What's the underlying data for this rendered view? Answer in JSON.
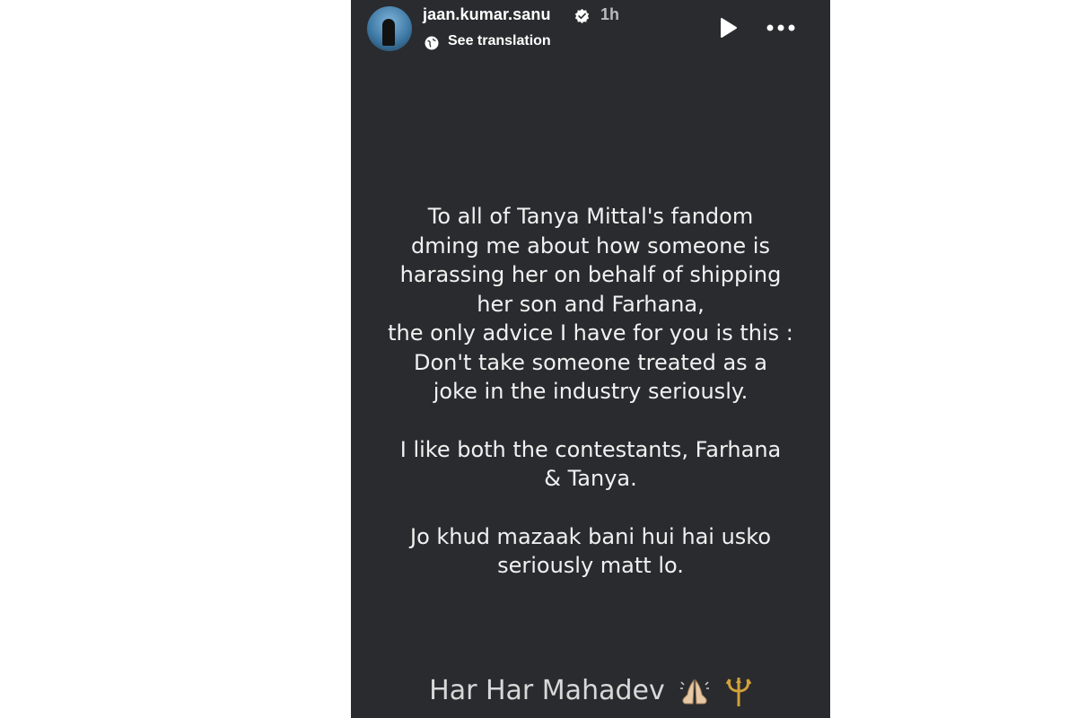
{
  "header": {
    "username": "jaan.kumar.sanu",
    "time": "1h",
    "translate_label": "See translation"
  },
  "icons": {
    "avatar": "profile-avatar",
    "verified": "verified-badge-icon",
    "globe": "globe-icon",
    "play": "play-icon",
    "more": "more-options-icon",
    "hands": "folded-hands-icon",
    "trident": "trident-icon"
  },
  "colors": {
    "background": "#2a2b2e",
    "text": "#f1f1f1",
    "muted": "#b9bcc2"
  },
  "story": {
    "paragraphs": [
      {
        "lines": [
          "To all of Tanya Mittal's fandom",
          "dming me about how someone is",
          "harassing her on behalf of shipping",
          "her son and Farhana,",
          "the only advice I have for you is this :",
          "Don't take someone treated as a",
          "joke in the industry seriously."
        ]
      },
      {
        "lines": [
          "I like both the contestants, Farhana",
          "& Tanya."
        ]
      },
      {
        "lines": [
          "Jo khud mazaak bani hui hai usko",
          "seriously matt lo."
        ]
      }
    ],
    "signoff": "Har Har Mahadev"
  }
}
